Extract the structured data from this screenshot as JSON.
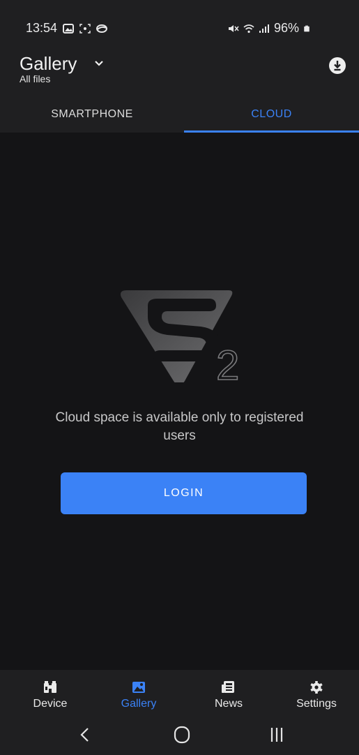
{
  "status_bar": {
    "time": "13:54",
    "battery": "96%"
  },
  "app_bar": {
    "title": "Gallery",
    "subtitle": "All files"
  },
  "tabs": [
    {
      "label": "SMARTPHONE",
      "active": false
    },
    {
      "label": "CLOUD",
      "active": true
    }
  ],
  "main": {
    "logo_text": "2",
    "message": "Cloud space is available only to registered users",
    "login_label": "LOGIN"
  },
  "bottom_nav": {
    "items": [
      {
        "label": "Device",
        "icon": "binoculars-icon",
        "active": false
      },
      {
        "label": "Gallery",
        "icon": "image-icon",
        "active": true
      },
      {
        "label": "News",
        "icon": "newspaper-icon",
        "active": false
      },
      {
        "label": "Settings",
        "icon": "gear-icon",
        "active": false
      }
    ]
  },
  "colors": {
    "accent": "#3b82f6",
    "background": "#141416",
    "bar": "#1f1f21"
  }
}
